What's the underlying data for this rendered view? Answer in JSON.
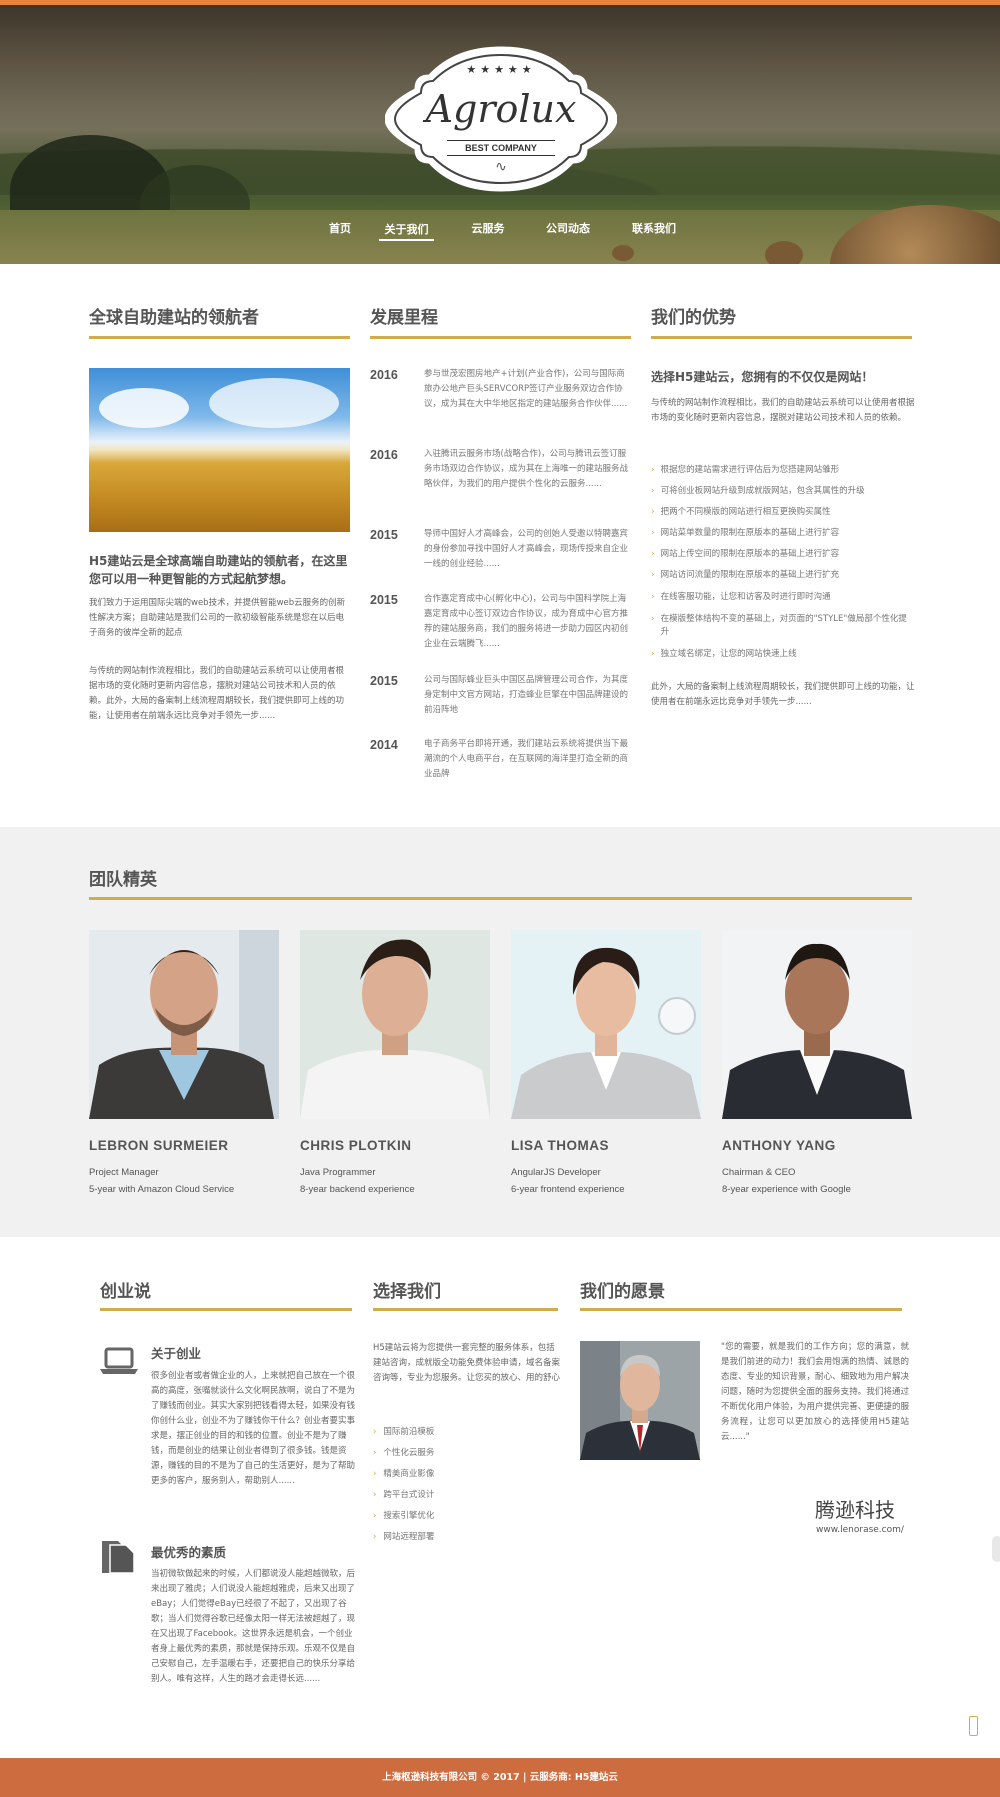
{
  "hero": {
    "stars": "★★★★★",
    "brand": "Agrolux",
    "tagline": "BEST COMPANY",
    "swirl": "∿"
  },
  "nav": [
    {
      "label": "首页"
    },
    {
      "label": "关于我们"
    },
    {
      "label": "云服务"
    },
    {
      "label": "公司动态"
    },
    {
      "label": "联系我们"
    }
  ],
  "col1": {
    "title": "全球自助建站的领航者",
    "headline": "H5建站云是全球高端自助建站的领航者，在这里您可以用一种更智能的方式起航梦想。",
    "p1": "我们致力于运用国际尖端的web技术，并提供智能web云服务的创新性解决方案；自助建站是我们公司的一款初级智能系统是您在以后电子商务的彼岸全新的起点",
    "p2": "与传统的网站制作流程相比，我们的自助建站云系统可以让使用者根据市场的变化随时更新内容信息，摆脱对建站公司技术和人员的依赖。此外，大局的备案制上线流程周期较长，我们提供即可上线的功能，让使用者在前端永远比竞争对手领先一步......"
  },
  "col2": {
    "title": "发展里程",
    "items": [
      {
        "year": "2016",
        "text": "参与世茂宏图房地产+计划(产业合作)，公司与国际商旅办公地产巨头SERVCORP签订产业服务双边合作协议，成为其在大中华地区指定的建站服务合作伙伴......"
      },
      {
        "year": "2016",
        "text": "入驻腾讯云服务市场(战略合作)，公司与腾讯云签订服务市场双边合作协议，成为其在上海唯一的建站服务战略伙伴，为我们的用户提供个性化的云服务......"
      },
      {
        "year": "2015",
        "text": "导师中国好人才高峰会，公司的创始人受邀以特聘嘉宾的身份参加寻找中国好人才高峰会，现场传授来自企业一线的创业经验......"
      },
      {
        "year": "2015",
        "text": "合作嘉定育成中心(孵化中心)，公司与中国科学院上海嘉定育成中心签订双边合作协议，成为育成中心官方推荐的建站服务商，我们的服务将进一步助力园区内初创企业在云端腾飞......"
      },
      {
        "year": "2015",
        "text": "公司与国际蜂业巨头中国区品牌管理公司合作，为其度身定制中文官方网站，打造蜂业巨擎在中国品牌建设的前沿阵地"
      },
      {
        "year": "2014",
        "text": "电子商务平台即将开通，我们建站云系统将提供当下最潮流的个人电商平台，在互联网的海洋里打造全新的商业品牌"
      }
    ]
  },
  "col3": {
    "title": "我们的优势",
    "headline": "选择H5建站云，您拥有的不仅仅是网站！",
    "intro": "与传统的网站制作流程相比，我们的自助建站云系统可以让使用者根据市场的变化随时更新内容信息，摆脱对建站公司技术和人员的依赖。",
    "items": [
      "根据您的建站需求进行评估后为您搭建网站雏形",
      "可将创业板网站升级到成就版网站，包含其属性的升级",
      "把两个不同模版的网站进行相互更换购买属性",
      "网站菜单数量的限制在原版本的基础上进行扩容",
      "网站上传空间的限制在原版本的基础上进行扩容",
      "网站访问流量的限制在原版本的基础上进行扩充",
      "在线客服功能，让您和访客及时进行即时沟通",
      "在模版整体结构不变的基础上，对页面的\"STYLE\"做局部个性化提升",
      "独立域名绑定，让您的网站快速上线"
    ],
    "outro": "此外，大局的备案制上线流程周期较长，我们提供即可上线的功能，让使用者在前端永远比竞争对手领先一步......"
  },
  "team": {
    "title": "团队精英",
    "members": [
      {
        "name": "LEBRON SURMEIER",
        "role": "Project Manager",
        "exp": "5-year with Amazon Cloud Service"
      },
      {
        "name": "CHRIS PLOTKIN",
        "role": "Java Programmer",
        "exp": "8-year backend experience"
      },
      {
        "name": "LISA THOMAS",
        "role": "AngularJS Developer",
        "exp": "6-year frontend experience"
      },
      {
        "name": "ANTHONY YANG",
        "role": "Chairman & CEO",
        "exp": "8-year experience with Google"
      }
    ]
  },
  "bottom1": {
    "title": "创业说",
    "h1": "关于创业",
    "t1": "很多创业者或者做企业的人，上来就把自己放在一个很高的高度，张嘴就谈什么文化啊民族啊，说白了不是为了赚钱而创业。其实大家别把钱看得太轻，如果没有钱你创什么业，创业不为了赚钱你干什么？创业者要实事求是，摆正创业的目的和钱的位置。创业不是为了赚钱，而是创业的结果让创业者得到了很多钱。钱是资源，赚钱的目的不是为了自己的生活更好，是为了帮助更多的客户，服务别人，帮助别人......",
    "h2": "最优秀的素质",
    "t2": "当初微软做起来的时候，人们都说没人能超越微软，后来出现了雅虎；人们说没人能超越雅虎，后来又出现了eBay；人们觉得eBay已经很了不起了，又出现了谷歌；当人们觉得谷歌已经像太阳一样无法被超越了，现在又出现了Facebook。这世界永远是机会，一个创业者身上最优秀的素质，那就是保持乐观。乐观不仅是自己安慰自己，左手温暖右手，还要把自己的快乐分享给别人。唯有这样，人生的路才会走得长远......"
  },
  "bottom2": {
    "title": "选择我们",
    "intro": "H5建站云将为您提供一套完整的服务体系，包括建站咨询，成就版全功能免费体验申请，域名备案咨询等，专业为您服务。让您买的放心、用的舒心",
    "items": [
      "国际前沿模板",
      "个性化云服务",
      "精美商业影像",
      "跨平台式设计",
      "搜索引擎优化",
      "网站远程部署"
    ]
  },
  "bottom3": {
    "title": "我们的愿景",
    "quote": "\"您的需要，就是我们的工作方向；您的满意，就是我们前进的动力！我们会用饱满的热情、诚恳的态度、专业的知识背景，耐心、细致地为用户解决问题，随时为您提供全面的服务支持。我们将通过不断优化用户体验，为用户提供完善、更便捷的服务流程，让您可以更加放心的选择使用H5建站云......\"",
    "brand_cn": "腾逊科技",
    "url": "www.lenorase.com/"
  },
  "footer": {
    "text": "上海枢逊科技有限公司 © 2017 | 云服务商: H5建站云"
  },
  "colors": {
    "accent": "#d0ac4a",
    "topbar": "#e9823a",
    "footer": "#cd6c3f",
    "team_bg": "#f1f1f1"
  }
}
